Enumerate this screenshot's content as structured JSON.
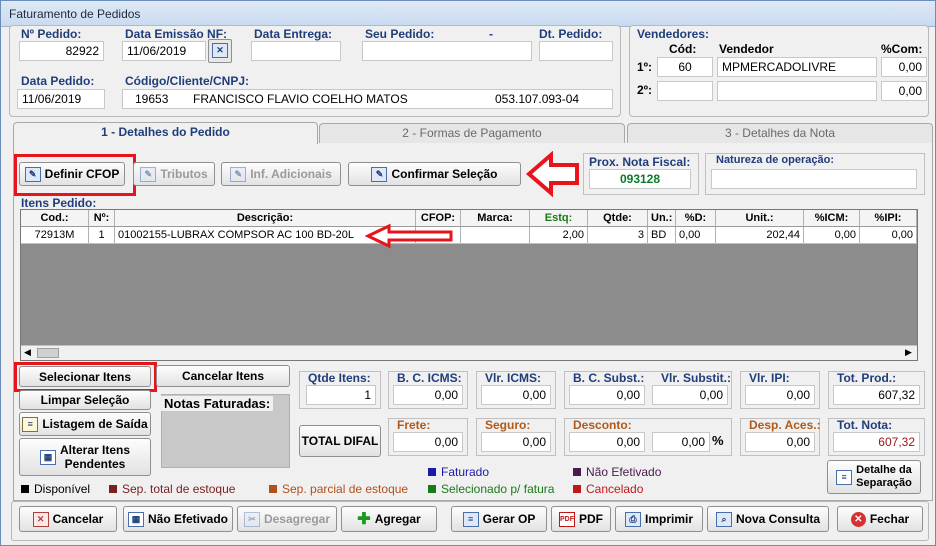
{
  "window": {
    "title": "Faturamento de Pedidos"
  },
  "header": {
    "pedido_label": "Nº Pedido:",
    "pedido_value": "82922",
    "emissao_label": "Data Emissão NF:",
    "emissao_value": "11/06/2019",
    "entrega_label": "Data Entrega:",
    "entrega_value": "",
    "seu_pedido_label": "Seu Pedido:",
    "seu_pedido_sep": "-",
    "seu_pedido_value": "",
    "dt_pedido_label": "Dt. Pedido:",
    "dt_pedido_value": "",
    "data_pedido_label": "Data Pedido:",
    "data_pedido_value": "11/06/2019",
    "cliente_label": "Código/Cliente/CNPJ:",
    "cliente_codigo": "19653",
    "cliente_nome": "FRANCISCO FLAVIO COELHO MATOS",
    "cliente_cnpj": "053.107.093-04"
  },
  "vendedores": {
    "title": "Vendedores:",
    "col_cod": "Cód:",
    "col_vendedor": "Vendedor",
    "col_com": "%Com:",
    "rows": [
      {
        "label": "1º:",
        "cod": "60",
        "vendedor": "MPMERCADOLIVRE",
        "com": "0,00"
      },
      {
        "label": "2º:",
        "cod": "",
        "vendedor": "",
        "com": "0,00"
      }
    ]
  },
  "tabs": [
    {
      "label": "1 - Detalhes do Pedido"
    },
    {
      "label": "2 - Formas de Pagamento"
    },
    {
      "label": "3 - Detalhes da Nota"
    }
  ],
  "toolbar": {
    "definir_cfop": "Definir CFOP",
    "tributos": "Tributos",
    "inf_adicionais": "Inf. Adicionais",
    "confirmar_selecao": "Confirmar Seleção",
    "prox_nota_label": "Prox. Nota Fiscal:",
    "prox_nota_value": "093128",
    "natureza_label": "Natureza de operação:",
    "natureza_value": ""
  },
  "itens": {
    "title": "Itens Pedido:",
    "columns": [
      "Cod.:",
      "Nº:",
      "Descrição:",
      "CFOP:",
      "Marca:",
      "Estq:",
      "Qtde:",
      "Un.:",
      "%D:",
      "Unit.:",
      "%ICM:",
      "%IPI:"
    ],
    "rows": [
      {
        "cod": "72913M",
        "n": "1",
        "descricao": "01002155-LUBRAX COMPSOR AC 100 BD-20L",
        "cfop": "",
        "marca": "",
        "estq": "2,00",
        "qtde": "3",
        "un": "BD",
        "d": "0,00",
        "unit": "202,44",
        "icm": "0,00",
        "ipi": "0,00"
      }
    ]
  },
  "actions": {
    "selecionar_itens": "Selecionar Itens",
    "cancelar_itens": "Cancelar Itens",
    "limpar_selecao": "Limpar Seleção",
    "notas_faturadas": "Notas Faturadas:",
    "listagem_saida": "Listagem de Saída",
    "alterar_itens_1": "Alterar Itens",
    "alterar_itens_2": "Pendentes"
  },
  "totals": {
    "qtde_itens_label": "Qtde Itens:",
    "qtde_itens": "1",
    "bc_icms_label": "B. C. ICMS:",
    "bc_icms": "0,00",
    "vlr_icms_label": "Vlr. ICMS:",
    "vlr_icms": "0,00",
    "bc_subst_label": "B. C. Subst.:",
    "bc_subst": "0,00",
    "vlr_substit_label": "Vlr. Substit.:",
    "vlr_substit": "0,00",
    "vlr_ipi_label": "Vlr. IPI:",
    "vlr_ipi": "0,00",
    "tot_prod_label": "Tot. Prod.:",
    "tot_prod": "607,32",
    "total_difal": "TOTAL DIFAL",
    "frete_label": "Frete:",
    "frete": "0,00",
    "seguro_label": "Seguro:",
    "seguro": "0,00",
    "desconto_label": "Desconto:",
    "desconto": "0,00",
    "desconto_pct": "0,00",
    "pct_symbol": "%",
    "desp_aces_label": "Desp. Aces.:",
    "desp_aces": "0,00",
    "tot_nota_label": "Tot. Nota:",
    "tot_nota": "607,32"
  },
  "legend": [
    {
      "text": "Faturado",
      "color": "#1a1aa8"
    },
    {
      "text": "Não Efetivado",
      "color": "#4a1a4a"
    },
    {
      "text": "Disponível",
      "color": "#000000"
    },
    {
      "text": "Sep. total de estoque",
      "color": "#7a1e1e"
    },
    {
      "text": "Sep. parcial de estoque",
      "color": "#b0501a"
    },
    {
      "text": "Selecionado p/ fatura",
      "color": "#1a7a1a"
    },
    {
      "text": "Cancelado",
      "color": "#c01818"
    }
  ],
  "detalhe_separacao_1": "Detalhe da",
  "detalhe_separacao_2": "Separação",
  "footer": {
    "cancelar": "Cancelar",
    "nao_efetivado": "Não Efetivado",
    "desagregar": "Desagregar",
    "agregar": "Agregar",
    "gerar_op": "Gerar OP",
    "pdf": "PDF",
    "pdf_icon": "PDF",
    "imprimir": "Imprimir",
    "nova_consulta": "Nova Consulta",
    "fechar": "Fechar"
  },
  "colors": {
    "label_blue": "#1f3d7a",
    "highlight_red": "#e8141c",
    "nota_green": "#0a7a2a",
    "tot_nota_red": "#a01818"
  }
}
